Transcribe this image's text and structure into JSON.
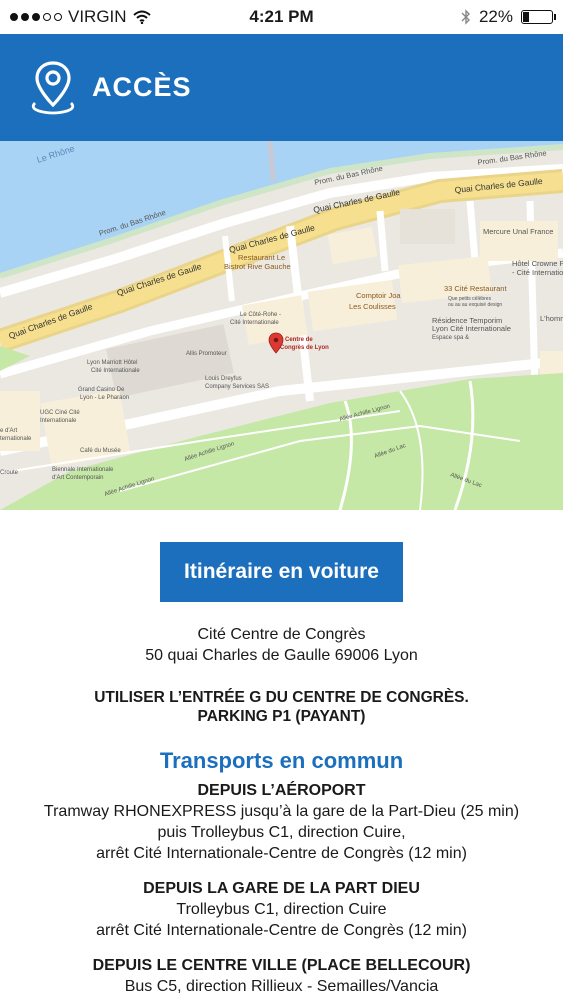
{
  "status_bar": {
    "carrier": "VIRGIN",
    "time": "4:21 PM",
    "battery": "22%",
    "battery_level": 0.22,
    "signal_bars_filled": 3,
    "signal_bars_total": 5
  },
  "header": {
    "title": "ACCÈS",
    "icon": "location-pin-icon"
  },
  "map": {
    "labels": {
      "river": "Le Rhône",
      "prom1": "Prom. du Bas Rhône",
      "prom2": "Prom. du Bas Rhône",
      "prom3": "Prom. du Bas Rhône",
      "quai1": "Quai Charles de Gaulle",
      "quai2": "Quai Charles de Gaulle",
      "quai3": "Quai Charles de Gaulle",
      "quai4": "Quai Charles de Gaulle",
      "quai5": "Quai Charles de Gaulle",
      "mercure": "Mercure Unal France",
      "crowne1": "Hôtel Crowne Plaza",
      "crowne2": "- Cité Internationale",
      "bistrot1": "Restaurant Le",
      "bistrot2": "Bistrot Rive Gauche",
      "comptoir": "Comptoir Joa",
      "cite_rest1": "33 Cité Restaurant",
      "cite_rest2": "Que petits célèbres",
      "cite_rest3": "ou au au exquisé design",
      "coulisses": "Les Coulisses",
      "cote1": "Le Côté-Rohe -",
      "cote2": "Cité Internationale",
      "centre1": "Centre de",
      "centre2": "Congrès de Lyon",
      "residence1": "Résidence Temporim",
      "residence2": "Lyon Cité Internationale",
      "residence3": "Espace spa &",
      "homme": "L'homme",
      "marriott1": "Lyon Marriott Hôtel",
      "marriott2": "Cité Internationale",
      "allis": "Allis Promoteur",
      "louis1": "Louis Dreyfus",
      "louis2": "Company Services SAS",
      "casino1": "Grand Casino De",
      "casino2": "Lyon - Le Pharaon",
      "ugc1": "UGC Ciné Cité",
      "ugc2": "Internationale",
      "art1": "e d'Art",
      "art2": "ternationale",
      "cafe": "Café du Musée",
      "biennale1": "Biennale Internationale",
      "biennale2": "d'Art Contemporain",
      "croute": "Croute",
      "allee1": "Allée Achille Lignon",
      "allee2": "Allée Achille Lignon",
      "allee3": "Allée Achille Lignon",
      "allee4": "Allée du Lac",
      "allee5": "Allée du Lac"
    }
  },
  "main": {
    "itinerary_button": "Itinéraire en voiture",
    "address_line1": "Cité Centre de Congrès",
    "address_line2": "50 quai Charles de Gaulle  69006 Lyon",
    "notice_line1": "UTILISER L’ENTRÉE G DU CENTRE DE CONGRÈS.",
    "notice_line2": "PARKING P1 (PAYANT)",
    "transport_title": "Transports en commun",
    "modes": [
      {
        "heading": "DEPUIS L’AÉROPORT",
        "lines": [
          "Tramway RHONEXPRESS jusqu’à la gare de la Part-Dieu (25 min)",
          "puis Trolleybus C1, direction Cuire,",
          "arrêt Cité Internationale-Centre de Congrès (12 min)"
        ]
      },
      {
        "heading": "DEPUIS LA GARE DE LA PART DIEU",
        "lines": [
          "Trolleybus C1, direction Cuire",
          "arrêt Cité Internationale-Centre de Congrès (12 min)"
        ]
      },
      {
        "heading": "DEPUIS LE CENTRE VILLE (PLACE BELLECOUR)",
        "lines": [
          "Bus C5, direction Rillieux - Semailles/Vancia"
        ]
      }
    ]
  },
  "colors": {
    "brand_blue": "#1c6fbd",
    "map_water": "#a9d3f5",
    "map_park": "#c5e8a6",
    "map_road": "#f5e28c",
    "map_marker": "#db3a34"
  }
}
